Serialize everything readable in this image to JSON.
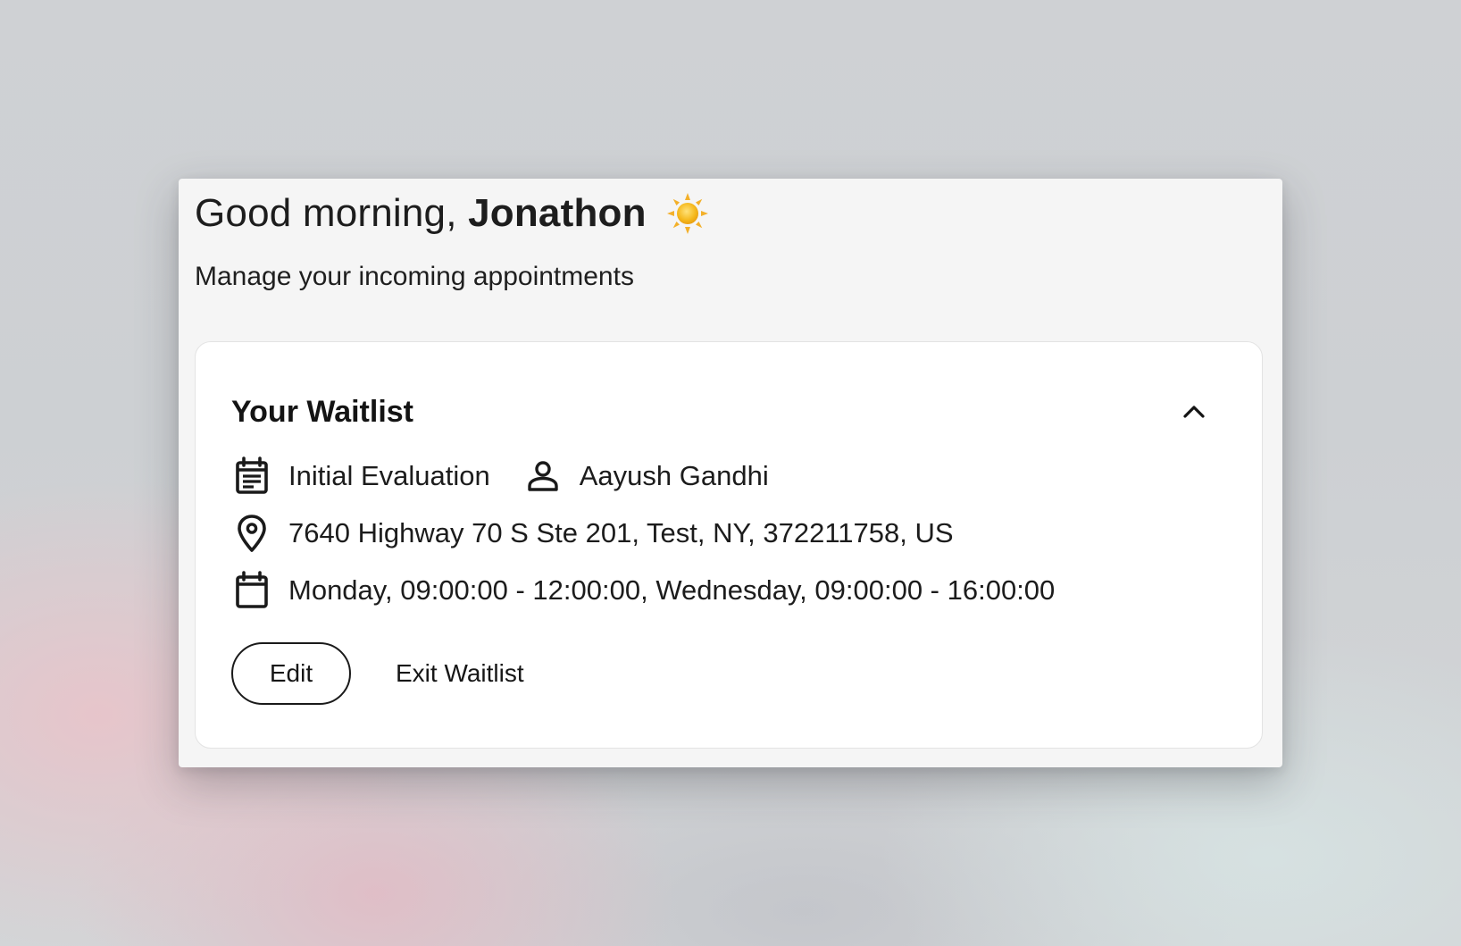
{
  "header": {
    "greeting_prefix": "Good morning,",
    "user_name": "Jonathon",
    "greeting_icon": "sun-icon",
    "subtitle": "Manage your incoming appointments"
  },
  "waitlist": {
    "title": "Your Waitlist",
    "collapse_icon": "chevron-up-icon",
    "appointment_type": "Initial Evaluation",
    "provider": "Aayush Gandhi",
    "address": "7640 Highway 70 S Ste 201, Test, NY, 372211758, US",
    "availability": "Monday, 09:00:00 - 12:00:00, Wednesday, 09:00:00 - 16:00:00",
    "icons": {
      "appointment_type": "event-note-icon",
      "provider": "person-icon",
      "address": "location-pin-icon",
      "availability": "calendar-icon"
    },
    "actions": {
      "edit_label": "Edit",
      "exit_label": "Exit Waitlist"
    }
  },
  "colors": {
    "window_bg": "#f5f5f5",
    "card_bg": "#ffffff",
    "text": "#1b1b1b",
    "sun": "#f5b81c"
  }
}
